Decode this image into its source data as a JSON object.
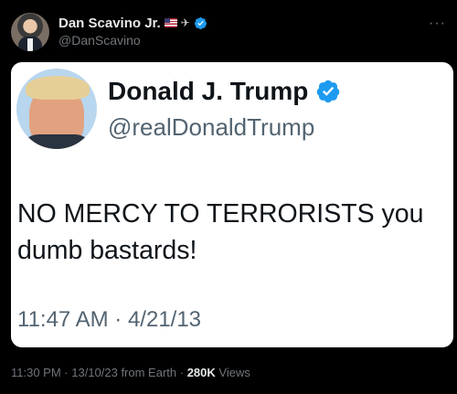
{
  "post": {
    "author_name": "Dan Scavino Jr.",
    "author_handle": "@DanScavino",
    "more_icon": "more-horizontal-icon",
    "verified_color": "#1d9bf0"
  },
  "embed": {
    "name": "Donald J. Trump",
    "handle": "@realDonaldTrump",
    "text": "NO MERCY TO TERRORISTS you dumb bastards!",
    "timestamp": "11:47 AM · 4/21/13"
  },
  "meta": {
    "timestamp": "11:30 PM · 13/10/23 from Earth",
    "separator": " · ",
    "views_count": "280K",
    "views_label": " Views"
  }
}
